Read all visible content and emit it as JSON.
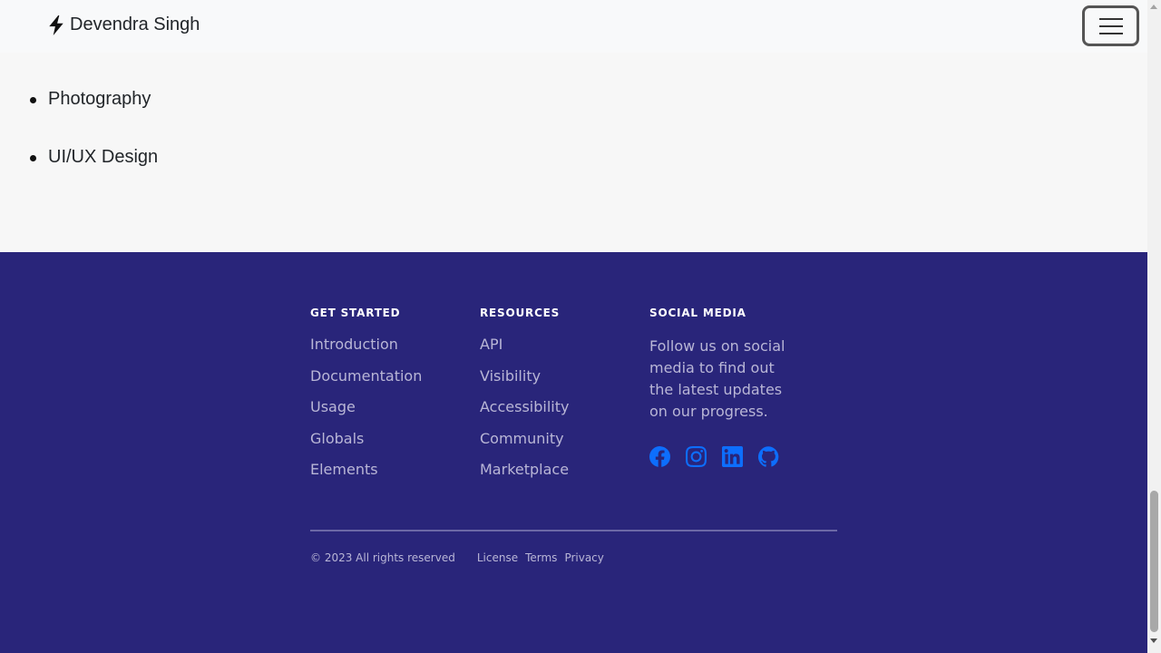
{
  "navbar": {
    "brand_name": "Devendra Singh",
    "brand_icon": "lightning-icon",
    "toggler_icon": "hamburger-menu-icon"
  },
  "hobbies": [
    "Photography",
    "UI/UX Design"
  ],
  "footer": {
    "get_started": {
      "title": "GET STARTED",
      "links": [
        "Introduction",
        "Documentation",
        "Usage",
        "Globals",
        "Elements"
      ]
    },
    "resources": {
      "title": "RESOURCES",
      "links": [
        "API",
        "Visibility",
        "Accessibility",
        "Community",
        "Marketplace"
      ]
    },
    "social": {
      "title": "SOCIAL MEDIA",
      "text": "Follow us on social media to find out the latest updates on our progress.",
      "icons": [
        "facebook-icon",
        "instagram-icon",
        "linkedin-icon",
        "github-icon"
      ]
    },
    "copyright": "© 2023 All rights reserved",
    "bottom_links": [
      "License",
      "Terms",
      "Privacy"
    ]
  },
  "colors": {
    "footer_bg": "#29257a",
    "icon_accent": "#0d6efd",
    "link_muted": "#b9b6d6"
  }
}
